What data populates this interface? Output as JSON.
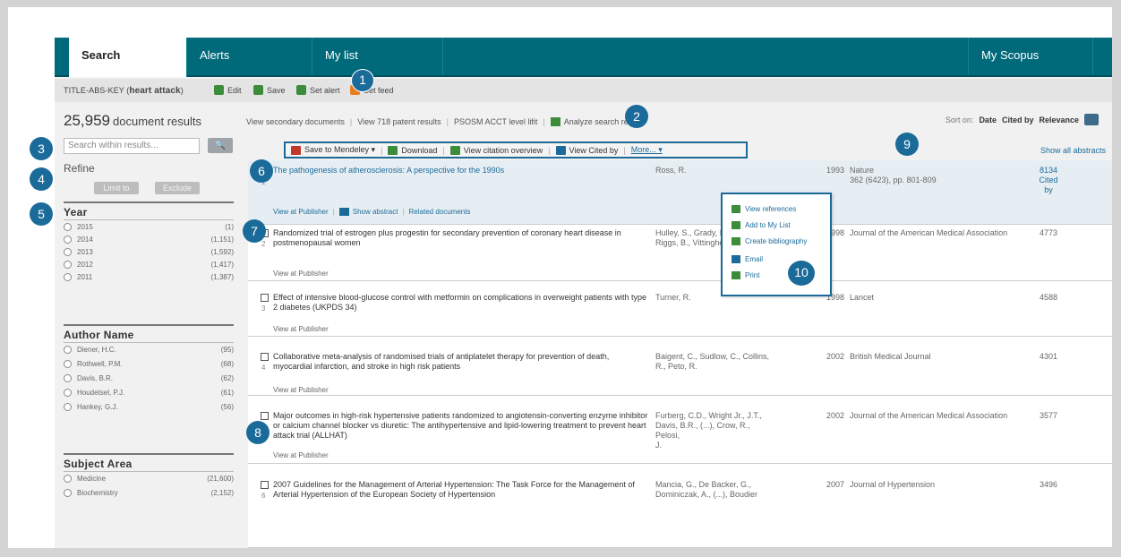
{
  "nav": {
    "tabs": [
      {
        "label": "Search",
        "active": true
      },
      {
        "label": "Alerts",
        "active": false
      },
      {
        "label": "My list",
        "active": false
      }
    ],
    "right_tab": "My Scopus"
  },
  "query": {
    "prefix": "TITLE-ABS-KEY (",
    "term": "heart attack",
    "suffix": ")",
    "actions": [
      {
        "label": "Edit",
        "icon": "edit-icon"
      },
      {
        "label": "Save",
        "icon": "save-icon"
      },
      {
        "label": "Set alert",
        "icon": "alert-icon"
      },
      {
        "label": "Set feed",
        "icon": "rss-icon"
      }
    ]
  },
  "results_header": {
    "count": "25,959",
    "count_label": "document results",
    "links": [
      "View secondary documents",
      "View 718 patent results",
      "PSOSM ACCT level lifit",
      "Analyze search results"
    ],
    "sort_label": "Sort on:",
    "sort_options": [
      "Date",
      "Cited by",
      "Relevance"
    ]
  },
  "left": {
    "search_placeholder": "Search within results...",
    "search_button": "🔍",
    "refine": "Refine",
    "limit": "Limit to",
    "exclude": "Exclude",
    "facets": [
      {
        "title": "Year",
        "items": [
          {
            "name": "2015",
            "count": "(1)"
          },
          {
            "name": "2014",
            "count": "(1,151)"
          },
          {
            "name": "2013",
            "count": "(1,592)"
          },
          {
            "name": "2012",
            "count": "(1,417)"
          },
          {
            "name": "2011",
            "count": "(1,387)"
          }
        ]
      },
      {
        "title": "Author Name",
        "items": [
          {
            "name": "Diener, H.C.",
            "count": "(95)"
          },
          {
            "name": "Rothwell, P.M.",
            "count": "(68)"
          },
          {
            "name": "Davis, B.R.",
            "count": "(62)"
          },
          {
            "name": "Houdetsel, P.J.",
            "count": "(61)"
          },
          {
            "name": "Hankey, G.J.",
            "count": "(56)"
          }
        ]
      },
      {
        "title": "Subject Area",
        "items": [
          {
            "name": "Medicine",
            "count": "(21,600)"
          },
          {
            "name": "Biochemistry",
            "count": "(2,152)"
          }
        ]
      }
    ]
  },
  "toolbar": {
    "items": [
      {
        "label": "Save to Mendeley ▾",
        "icon": "mendeley-icon",
        "color": "#c0392b"
      },
      {
        "label": "Download",
        "icon": "download-icon",
        "color": "#3b8c3b"
      },
      {
        "label": "View citation overview",
        "icon": "citation-icon",
        "color": "#3b8c3b"
      },
      {
        "label": "View Cited by",
        "icon": "quote-icon",
        "color": "#1b6b9a"
      },
      {
        "label": "More... ▾",
        "icon": "",
        "color": ""
      }
    ],
    "show_abstracts": "Show all abstracts"
  },
  "results": [
    {
      "checked": true,
      "num": "1",
      "title": "The pathogenesis of atherosclerosis: A perspective for the 1990s",
      "authors": "Ross, R.",
      "year": "1993",
      "source": "Nature\n362 (6423), pp. 801-809",
      "cited": "8134\nCited\nby",
      "links": [
        "View at Publisher",
        "Show abstract",
        "Related documents"
      ]
    },
    {
      "checked": true,
      "num": "2",
      "title": "Randomized trial of estrogen plus progestin for secondary prevention of coronary heart disease in postmenopausal women",
      "authors": "Hulley, S., Grady, D.,\nRiggs, B., Vittinghoff, E.",
      "year": "1998",
      "source": "Journal of the American Medical Association",
      "cited": "4773",
      "links": [
        "View at Publisher"
      ]
    },
    {
      "checked": false,
      "num": "3",
      "title": "Effect of intensive blood-glucose control with metformin on complications in overweight patients with type 2 diabetes (UKPDS 34)",
      "authors": "Turner, R.",
      "year": "1998",
      "source": "Lancet",
      "cited": "4588",
      "links": [
        "View at Publisher"
      ]
    },
    {
      "checked": false,
      "num": "4",
      "title": "Collaborative meta-analysis of randomised trials of antiplatelet therapy for prevention of death, myocardial infarction, and stroke in high risk patients",
      "authors": "Baigent, C., Sudlow, C., Collins,\nR., Peto, R.",
      "year": "2002",
      "source": "British Medical Journal",
      "cited": "4301",
      "links": [
        "View at Publisher"
      ]
    },
    {
      "checked": false,
      "num": "5",
      "title": "Major outcomes in high-risk hypertensive patients randomized to angiotensin-converting enzyme inhibitor or calcium channel blocker vs diuretic: The antihypertensive and lipid-lowering treatment to prevent heart attack trial (ALLHAT)",
      "authors": "Furberg, C.D., Wright Jr., J.T.,\nDavis, B.R., (...), Crow, R., Pelosi,\nJ.",
      "year": "2002",
      "source": "Journal of the American Medical Association",
      "cited": "3577",
      "links": [
        "View at Publisher"
      ]
    },
    {
      "checked": false,
      "num": "6",
      "title": "2007 Guidelines for the Management of Arterial Hypertension: The Task Force for the Management of Arterial Hypertension of the European Society of Hypertension",
      "authors": "Mancia, G., De Backer, G.,\nDominiczak, A., (...), Boudier",
      "year": "2007",
      "source": "Journal of Hypertension",
      "cited": "3496",
      "links": []
    }
  ],
  "dropdown": [
    {
      "label": "View references",
      "icon": "references-icon",
      "color": "#3b8c3b"
    },
    {
      "label": "Add to My List",
      "icon": "add-icon",
      "color": "#3b8c3b"
    },
    {
      "label": "Create bibliography",
      "icon": "bibliography-icon",
      "color": "#3b8c3b"
    },
    {
      "label": "Email",
      "icon": "email-icon",
      "color": "#1b6b9a"
    },
    {
      "label": "Print",
      "icon": "print-icon",
      "color": "#3b8c3b"
    }
  ],
  "callouts": [
    "1",
    "2",
    "3",
    "4",
    "5",
    "6",
    "7",
    "8",
    "9",
    "10"
  ],
  "colors": {
    "brand": "#00697a",
    "accent": "#1b6b9a"
  }
}
